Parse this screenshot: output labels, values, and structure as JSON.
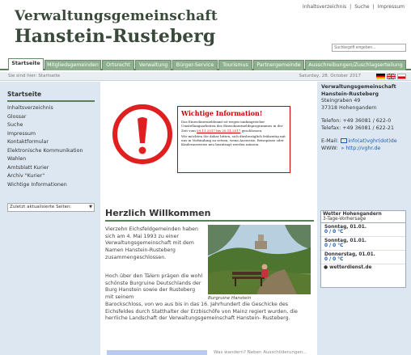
{
  "topbar": {
    "links": [
      "Inhaltsverzeichnis",
      "Suche",
      "Impressum"
    ],
    "separator": "|"
  },
  "header": {
    "title_line1": "Verwaltungsgemeinschaft",
    "title_line2": "Hanstein-Rusteberg",
    "search_placeholder": "Suchbegriff eingeben..."
  },
  "tabs": [
    {
      "label": "Startseite",
      "active": true
    },
    {
      "label": "Mitgliedsgemeinden"
    },
    {
      "label": "Ortsrecht"
    },
    {
      "label": "Verwaltung"
    },
    {
      "label": "Bürger-Service"
    },
    {
      "label": "Tourismus"
    },
    {
      "label": "Partnergemeinde"
    },
    {
      "label": "Ausschreibungen/Zuschlagserteilung"
    }
  ],
  "breadcrumb": "Sie sind hier: Startseite",
  "date": "Saturday, 28. October 2017",
  "leftnav": {
    "heading": "Startseite",
    "items": [
      "Inhaltsverzeichnis",
      "Glossar",
      "Suche",
      "Impressum",
      "Kontaktformular",
      "Elektronische Kommunikation",
      "Wahlen",
      "Amtsblatt Kurier",
      "Archiv \"Kurier\"",
      "Wichtige Informationen"
    ],
    "select_value": "Zuletzt aktualisierte Seiten:"
  },
  "alert": {
    "title": "Wichtige Information!",
    "text_before": "Das Einwohnermeldeamt ist wegen umfangreicher Umstellungsarbeiten des Einwohnermeldeprogrammes in der Zeit vom ",
    "text_dates": "09.11.2017 bis 20.11.2017",
    "text_after": " geschlossen.",
    "text2": "Wir möchten Sie daher bitten, sich diesbezüglich frühzeitig mit uns in Verbindung zu setzen, wenn Ausweise, Reisepässe oder Kinderausweise neu beantragt werden müssen."
  },
  "main": {
    "heading": "Herzlich Willkommen",
    "para1": "Vierzehn Eichsfeldgemeinden haben sich am 4. Mai 1993 zu einer Verwaltungsgemeinschaft mit dem Namen Hanstein-Rusteberg zusammengeschlossen.",
    "para2": "Hoch über den Tälern prägen die wohl schönste Burgruine Deutschlands der Burg Hanstein sowie der Rusteberg mit seinem",
    "para3": "Barockschloss, von wo aus bis in das 16. Jahrhundert die Geschicke des Eichsfeldes durch Statthalter der Erzbischöfe von Mainz regiert wurden, die herrliche Landschaft der Verwaltungsgemeinschaft Hanstein- Rusteberg.",
    "caption": "Burgruine Hanstein",
    "footer_text": "Was wandern? Neben Ausschilderungen..."
  },
  "contact": {
    "name1": "Verwaltungsgemeinschaft",
    "name2": "Hanstein-Rusteberg",
    "street": "Steingraben 49",
    "city": "37318 Hohengandern",
    "phone1": "Telefon: +49 36081 / 622-0",
    "phone2": "Telefax: +49 36081 / 622-21",
    "email_label": "E-Mail:",
    "email_value": "info(at)vghr(dot)de",
    "www_label": "WWW:",
    "www_value": "http://vghr.de"
  },
  "weather": {
    "title": "Wetter Hohengandern",
    "subtitle": "3-Tage-Vorhersage",
    "days": [
      {
        "day": "Sonntag, 01.01.",
        "temp": "0 / 0 °C"
      },
      {
        "day": "Sonntag, 01.01.",
        "temp": "0 / 0 °C"
      },
      {
        "day": "Donnerstag, 01.01.",
        "temp": "0 / 0 °C"
      }
    ],
    "footer": "wetterdienst.de"
  }
}
